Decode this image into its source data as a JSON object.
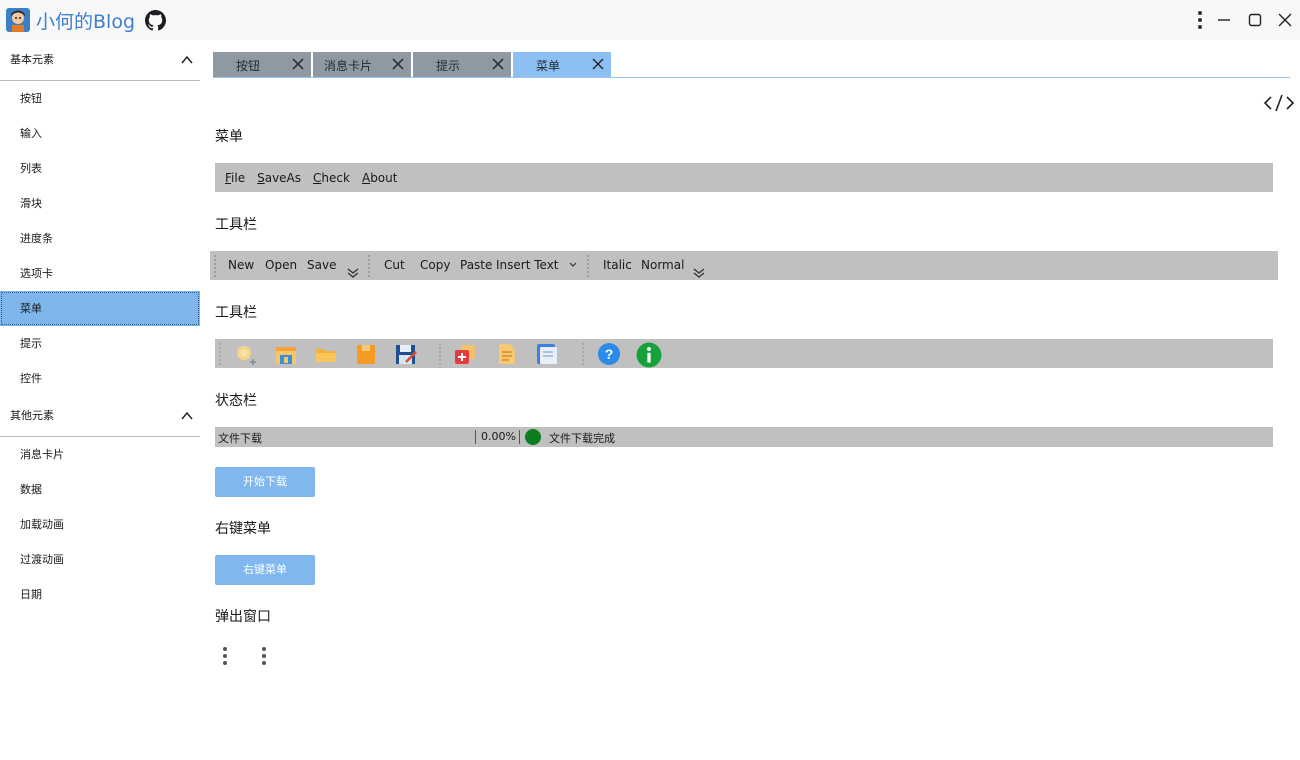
{
  "app": {
    "title": "小何的Blog"
  },
  "sidebar": {
    "groups": [
      {
        "label": "基本元素",
        "items": [
          {
            "label": "按钮"
          },
          {
            "label": "输入"
          },
          {
            "label": "列表"
          },
          {
            "label": "滑块"
          },
          {
            "label": "进度条"
          },
          {
            "label": "选项卡"
          },
          {
            "label": "菜单",
            "active": true
          },
          {
            "label": "提示"
          },
          {
            "label": "控件"
          }
        ]
      },
      {
        "label": "其他元素",
        "items": [
          {
            "label": "消息卡片"
          },
          {
            "label": "数据"
          },
          {
            "label": "加载动画"
          },
          {
            "label": "过渡动画"
          },
          {
            "label": "日期"
          }
        ]
      }
    ]
  },
  "tabs": [
    {
      "label": "按钮"
    },
    {
      "label": "消息卡片"
    },
    {
      "label": "提示"
    },
    {
      "label": "菜单",
      "active": true
    }
  ],
  "sections": {
    "menu": "菜单",
    "toolbar1": "工具栏",
    "toolbar2": "工具栏",
    "statusbar": "状态栏",
    "context_menu": "右键菜单",
    "popup": "弹出窗口"
  },
  "menubar": {
    "items": [
      {
        "accel": "F",
        "rest": "ile"
      },
      {
        "accel": "S",
        "rest": "aveAs"
      },
      {
        "accel": "C",
        "rest": "heck"
      },
      {
        "accel": "A",
        "rest": "bout"
      }
    ]
  },
  "toolbar": {
    "new": "New",
    "open": "Open",
    "save": "Save",
    "cut": "Cut",
    "copy": "Copy",
    "paste": "Paste",
    "insert_text": "Insert Text",
    "italic": "Italic",
    "normal": "Normal"
  },
  "iconbar": {
    "icons": [
      "new-file-icon",
      "save-all-icon",
      "folder-open-icon",
      "clipboard-icon",
      "save-edit-icon",
      "add-copy-icon",
      "document-list-icon",
      "notes-icon",
      "help-icon",
      "info-icon"
    ]
  },
  "statusbar": {
    "text": "文件下载",
    "progress": "0.00%",
    "status": "文件下载完成",
    "status_color": "#0d7d1f"
  },
  "buttons": {
    "start_download": "开始下载",
    "context_menu": "右键菜单"
  },
  "colors": {
    "accent": "#7fb7ee",
    "active_nav": "#7eb6ec",
    "active_tab": "#8dc0f2",
    "inactive_tab": "#8f99a3",
    "bar_bg": "#c0c0c0"
  }
}
